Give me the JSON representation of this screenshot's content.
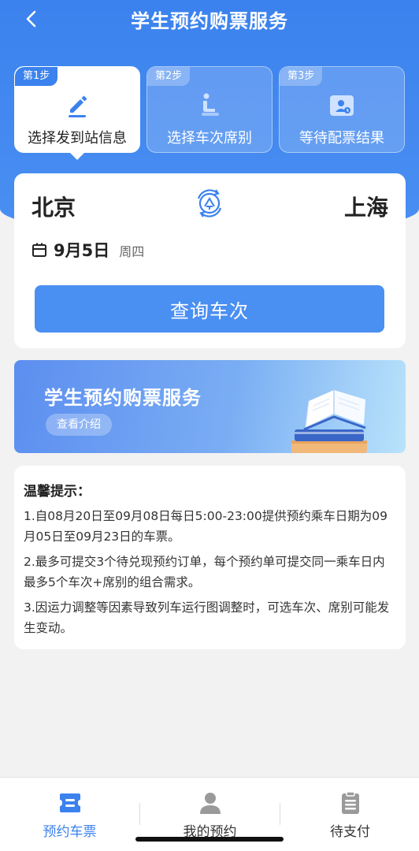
{
  "header": {
    "title": "学生预约购票服务"
  },
  "steps": [
    {
      "tag": "第1步",
      "label": "选择发到站信息",
      "active": true
    },
    {
      "tag": "第2步",
      "label": "选择车次席别",
      "active": false
    },
    {
      "tag": "第3步",
      "label": "等待配票结果",
      "active": false
    }
  ],
  "route": {
    "from": "北京",
    "to": "上海",
    "date": "9月5日",
    "weekday": "周四",
    "query_label": "查询车次"
  },
  "banner": {
    "title": "学生预约购票服务",
    "button": "查看介绍"
  },
  "tips": {
    "title": "温馨提示：",
    "items": [
      "1.自08月20日至09月08日每日5:00-23:00提供预约乘车日期为09月05日至09月23日的车票。",
      "2.最多可提交3个待兑现预约订单，每个预约单可提交同一乘车日内最多5个车次+席别的组合需求。",
      "3.因运力调整等因素导致列车运行图调整时，可选车次、席别可能发生变动。"
    ]
  },
  "tabbar": [
    {
      "label": "预约车票",
      "icon": "ticket-icon",
      "active": true
    },
    {
      "label": "我的预约",
      "icon": "user-icon",
      "active": false
    },
    {
      "label": "待支付",
      "icon": "clipboard-icon",
      "active": false
    }
  ],
  "colors": {
    "primary": "#3b82ee",
    "button": "#4a8ff2",
    "background": "#f2f2f2"
  }
}
